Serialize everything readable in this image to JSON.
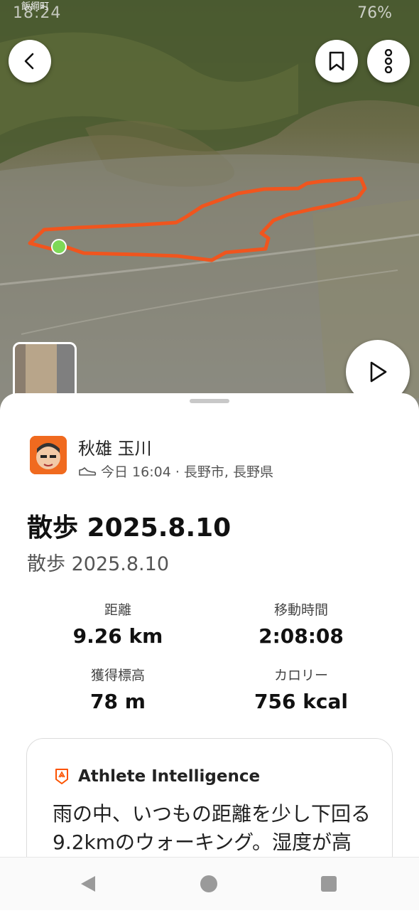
{
  "status_bar": {
    "time": "18:24",
    "location_label": "飯綱町",
    "battery": "76%"
  },
  "map": {
    "route_color": "#f0551e",
    "start_marker_color": "#7ed957"
  },
  "athlete": {
    "name": "秋雄 玉川",
    "meta": "今日 16:04 · 長野市, 長野県",
    "activity_icon": "shoe-icon"
  },
  "activity": {
    "title": "散歩 2025.8.10",
    "description": "散歩 2025.8.10"
  },
  "stats": [
    {
      "label": "距離",
      "value": "9.26 km"
    },
    {
      "label": "移動時間",
      "value": "2:08:08"
    },
    {
      "label": "獲得標高",
      "value": "78 m"
    },
    {
      "label": "カロリー",
      "value": "756 kcal"
    }
  ],
  "athlete_intelligence": {
    "title": "Athlete Intelligence",
    "text": "雨の中、いつもの距離を少し下回る9.2kmのウォーキング。湿度が高く、ペースも少し遅"
  },
  "accent_color": "#fc5200"
}
